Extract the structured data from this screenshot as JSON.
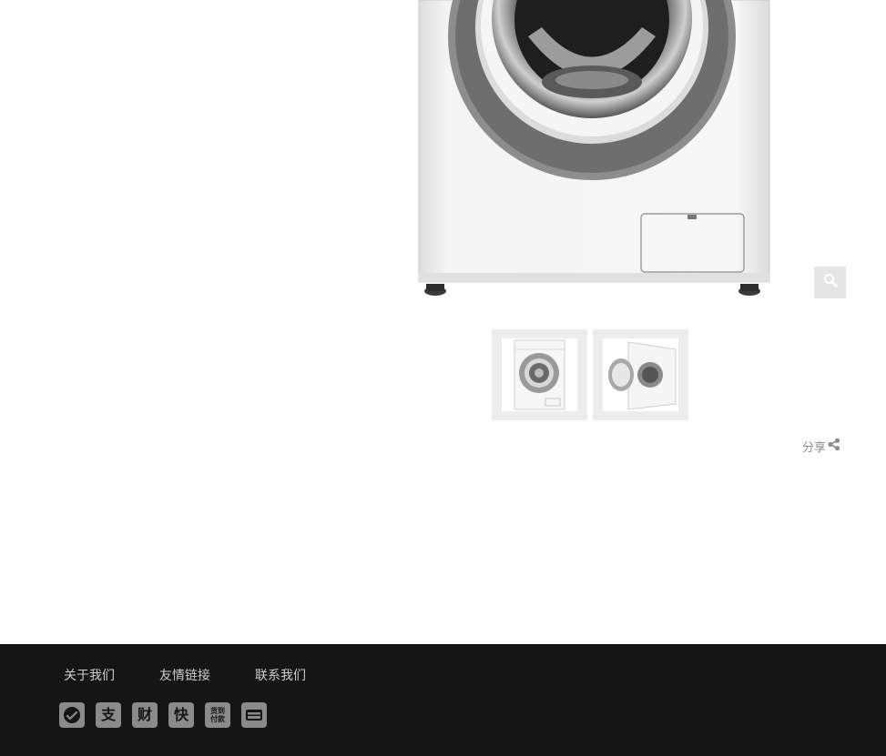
{
  "product": {
    "zoom_icon": "magnifier-icon",
    "thumbnails": [
      "washing-machine-front",
      "washing-machine-door-open"
    ]
  },
  "share": {
    "label": "分享",
    "icon": "share-icon"
  },
  "footer": {
    "links": [
      "关于我们",
      "友情链接",
      "联系我们"
    ],
    "payment_icons": [
      {
        "name": "wechat-pay-icon",
        "glyph": ""
      },
      {
        "name": "alipay-icon",
        "glyph": "支"
      },
      {
        "name": "caifutong-icon",
        "glyph": "财"
      },
      {
        "name": "kuaiqian-icon",
        "glyph": "快"
      },
      {
        "name": "cash-on-delivery-icon",
        "glyph_top": "货到",
        "glyph_bottom": "付款"
      },
      {
        "name": "bank-card-icon",
        "glyph": ""
      }
    ]
  },
  "colors": {
    "footer_bg": "#151515",
    "footer_text": "#cfcfcf",
    "icon_bg": "#8a8a8a"
  }
}
